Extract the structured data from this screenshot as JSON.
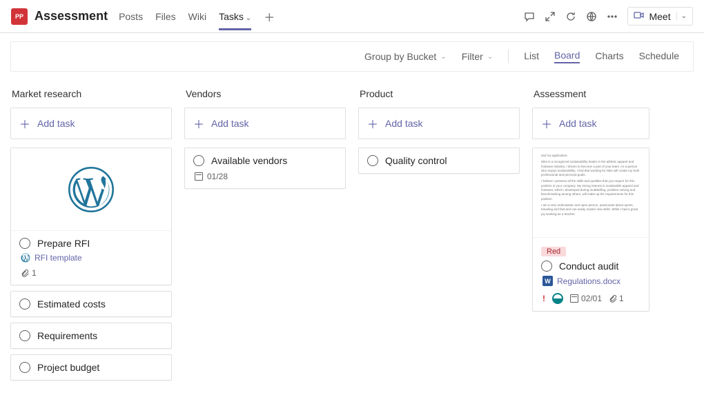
{
  "header": {
    "badge": "PP",
    "title": "Assessment",
    "tabs": [
      "Posts",
      "Files",
      "Wiki",
      "Tasks"
    ],
    "active_tab": 3,
    "meet_label": "Meet"
  },
  "toolbar": {
    "group_label": "Group by Bucket",
    "filter_label": "Filter",
    "views": [
      "List",
      "Board",
      "Charts",
      "Schedule"
    ],
    "active_view": 1
  },
  "columns": [
    {
      "title": "Market research",
      "add_label": "Add task",
      "cards": [
        {
          "type": "image",
          "title": "Prepare RFI",
          "link_label": "RFI template",
          "attachments": "1"
        },
        {
          "type": "simple",
          "title": "Estimated costs"
        },
        {
          "type": "simple",
          "title": "Requirements"
        },
        {
          "type": "simple",
          "title": "Project budget"
        }
      ]
    },
    {
      "title": "Vendors",
      "add_label": "Add task",
      "cards": [
        {
          "type": "dated",
          "title": "Available vendors",
          "date": "01/28"
        }
      ]
    },
    {
      "title": "Product",
      "add_label": "Add task",
      "cards": [
        {
          "type": "simple",
          "title": "Quality control"
        }
      ]
    },
    {
      "title": "Assessment",
      "add_label": "Add task",
      "cards": [
        {
          "type": "doc",
          "tag": "Red",
          "title": "Conduct audit",
          "doc_label": "Regulations.docx",
          "date": "02/01",
          "attachments": "1"
        }
      ]
    }
  ]
}
